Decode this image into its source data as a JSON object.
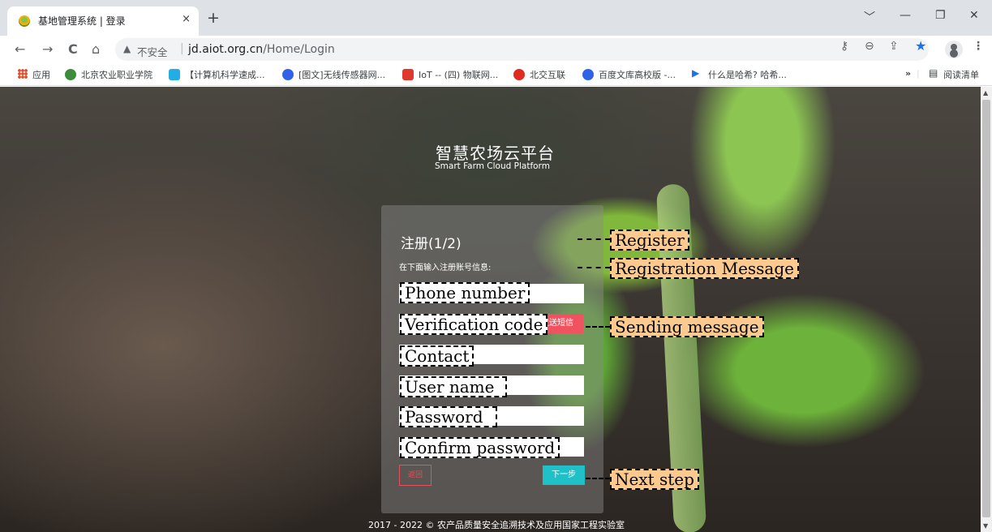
{
  "browser": {
    "tab_title": "基地管理系统 | 登录",
    "tab_close": "×",
    "new_tab": "+",
    "window_controls": [
      "﹀",
      "—",
      "❐",
      "✕"
    ],
    "nav": {
      "back": "←",
      "forward": "→",
      "reload": "C",
      "home": "⌂"
    },
    "security_warning": "不安全",
    "url_host": "jd.aiot.org.cn",
    "url_path": "/Home/Login",
    "toolbar_icons": [
      "key-icon",
      "zoom-icon",
      "share-icon",
      "star-icon",
      "profile-icon",
      "menu-icon"
    ],
    "bookmarks": [
      {
        "label": "应用",
        "icon": "apps-icon"
      },
      {
        "label": "北京农业职业学院",
        "icon": "school-icon"
      },
      {
        "label": "【计算机科学速成...",
        "icon": "bilibili-icon"
      },
      {
        "label": "[图文]无线传感器网...",
        "icon": "baidu-icon"
      },
      {
        "label": "IoT -- (四) 物联网...",
        "icon": "csdn-icon"
      },
      {
        "label": "北交互联",
        "icon": "red-icon"
      },
      {
        "label": "百度文库高校版 -...",
        "icon": "baidu-icon"
      },
      {
        "label": "什么是哈希? 哈希...",
        "icon": "play-icon"
      }
    ],
    "more_bookmarks": "»",
    "reading_list": "阅读清单",
    "colors": {
      "tabstrip": "#dee1e6",
      "star": "#1a73e8"
    }
  },
  "page": {
    "brand_cn": "智慧农场云平台",
    "brand_en": "Smart Farm Cloud Platform",
    "form": {
      "title": "注册(1/2)",
      "subtitle": "在下面输入注册账号信息:",
      "send_sms_label": "发送短信",
      "back_label": "返回",
      "next_label": "下一步"
    },
    "footer": "2017 - 2022 © 农产品质量安全追溯技术及应用国家工程实验室",
    "colors": {
      "send_button": "#f0525f",
      "next_button": "#20c0c8",
      "back_border": "#e4505d"
    }
  },
  "annotations": {
    "register": "Register",
    "registration_message": "Registration Message",
    "phone_number": "Phone number",
    "verification_code": "Verification code",
    "sending_message": "Sending message",
    "contact": "Contact",
    "user_name": "User name",
    "password": "Password",
    "confirm_password": "Confirm password",
    "next_step": "Next step"
  }
}
